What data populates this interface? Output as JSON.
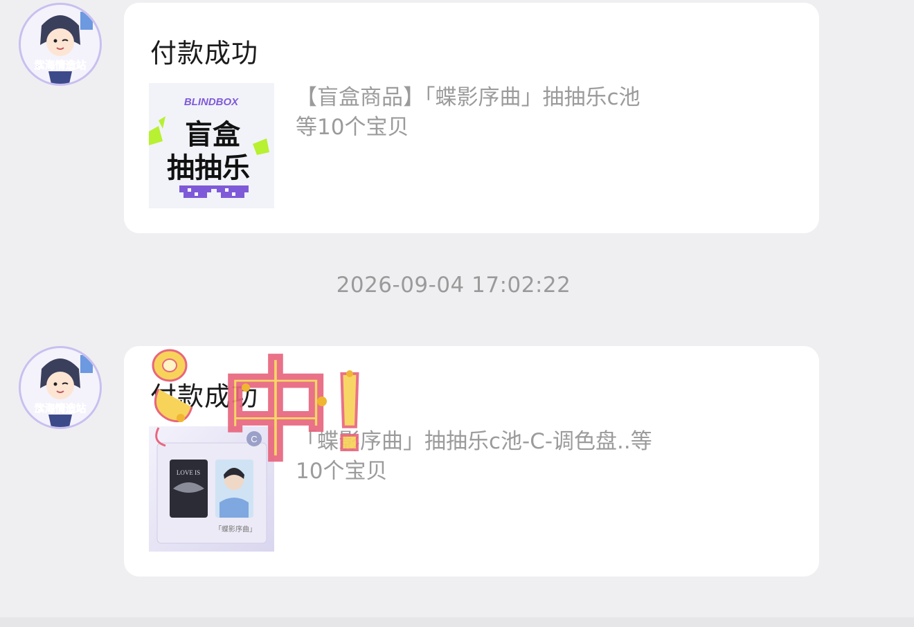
{
  "messages": [
    {
      "title": "付款成功",
      "description_line1": "【盲盒商品】「蝶影序曲」抽抽乐c池",
      "description_line2": "等10个宝贝",
      "thumbnail": {
        "brand": "BLINDBOX",
        "line1": "盲盒",
        "line2": "抽抽乐"
      }
    },
    {
      "title": "付款成功",
      "description_line1": "「蝶影序曲」抽抽乐c池-C-调色盘..等",
      "description_line2": "10个宝贝",
      "thumbnail": {
        "badge": "C",
        "card_text": "LOVE IS",
        "caption": "「蝶影序曲」"
      }
    }
  ],
  "timestamp": "2026-09-04 17:02:22",
  "avatar_text": "紫海情造站",
  "sticker_text": "中!",
  "colors": {
    "background": "#efeff1",
    "card": "#ffffff",
    "title": "#1b1b1b",
    "desc": "#9b9b9b",
    "sticker_fill": "#f7d35a",
    "sticker_stroke": "#e8667e",
    "accent_purple": "#7f5ad8",
    "accent_green": "#b8f032"
  }
}
